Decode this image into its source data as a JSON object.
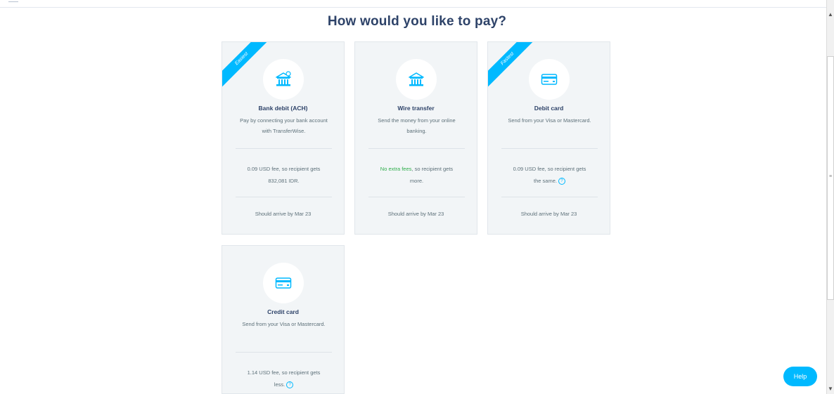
{
  "page": {
    "title": "How would you like to pay?"
  },
  "colors": {
    "accent": "#00b9ff",
    "title_text": "#2e4369",
    "body_text": "#5d7079",
    "card_bg": "#f2f5f7",
    "positive": "#2ead4b"
  },
  "payment_options": [
    {
      "ribbon": "Easiest",
      "icon": "bank-ach-icon",
      "title": "Bank debit (ACH)",
      "description": "Pay by connecting your bank account with TransferWise.",
      "fee_line1": "0.09 USD fee, so recipient gets",
      "fee_line2": "832,081 IDR.",
      "arrival": "Should arrive by Mar 23"
    },
    {
      "icon": "bank-icon",
      "title": "Wire transfer",
      "description": "Send the money from your online banking.",
      "fee_highlight": "No extra fees",
      "fee_line1_rest": ", so recipient gets",
      "fee_line2": "more.",
      "arrival": "Should arrive by Mar 23"
    },
    {
      "ribbon": "Fastest",
      "icon": "card-icon",
      "title": "Debit card",
      "description": "Send from your Visa or Mastercard.",
      "fee_line1": "0.09 USD fee, so recipient gets",
      "fee_line2": "the same.",
      "arrival": "Should arrive by Mar 23"
    },
    {
      "icon": "card-icon",
      "title": "Credit card",
      "description": "Send from your Visa or Mastercard.",
      "fee_line1": "1.14 USD fee, so recipient gets",
      "fee_line2": "less."
    }
  ],
  "help": {
    "label": "Help"
  },
  "info_glyph": "?"
}
